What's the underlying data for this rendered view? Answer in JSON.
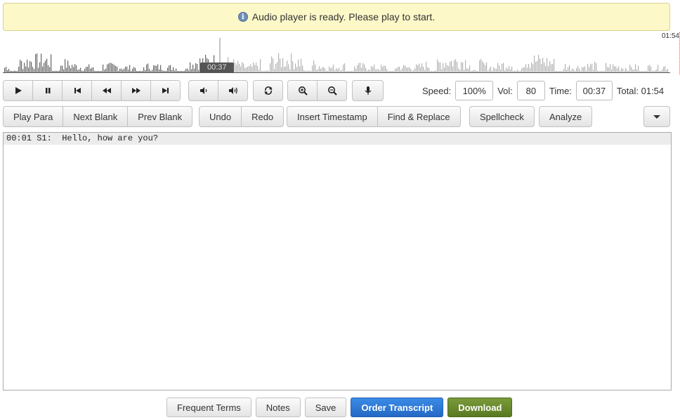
{
  "notice": {
    "text": "Audio player is ready. Please play to start.",
    "icon": "info-icon"
  },
  "waveform": {
    "current_time": "00:37",
    "total_time": "01:54",
    "progress": 0.325
  },
  "transport": {
    "icons": [
      "play-icon",
      "pause-icon",
      "skip-back-icon",
      "rewind-icon",
      "fast-forward-icon",
      "skip-forward-icon"
    ],
    "volume_icons": [
      "volume-down-icon",
      "volume-up-icon"
    ],
    "loop_icon": "loop-icon",
    "zoom_icons": [
      "zoom-in-icon",
      "zoom-out-icon"
    ],
    "mic_icon": "microphone-icon"
  },
  "player": {
    "speed_label": "Speed:",
    "speed_value": "100%",
    "vol_label": "Vol:",
    "vol_value": "80",
    "time_label": "Time:",
    "time_value": "00:37",
    "total_label": "Total: 01:54"
  },
  "toolbar": {
    "play_para": "Play Para",
    "next_blank": "Next Blank",
    "prev_blank": "Prev Blank",
    "undo": "Undo",
    "redo": "Redo",
    "insert_timestamp": "Insert Timestamp",
    "find_replace": "Find & Replace",
    "spellcheck": "Spellcheck",
    "analyze": "Analyze"
  },
  "editor": {
    "lines": [
      "00:01 S1:  Hello, how are you?"
    ]
  },
  "footer": {
    "frequent_terms": "Frequent Terms",
    "notes": "Notes",
    "save": "Save",
    "order_transcript": "Order Transcript",
    "download": "Download"
  },
  "colors": {
    "primary": "#2468c6",
    "success": "#5a7a22",
    "notice_bg": "#fcf8c8"
  }
}
